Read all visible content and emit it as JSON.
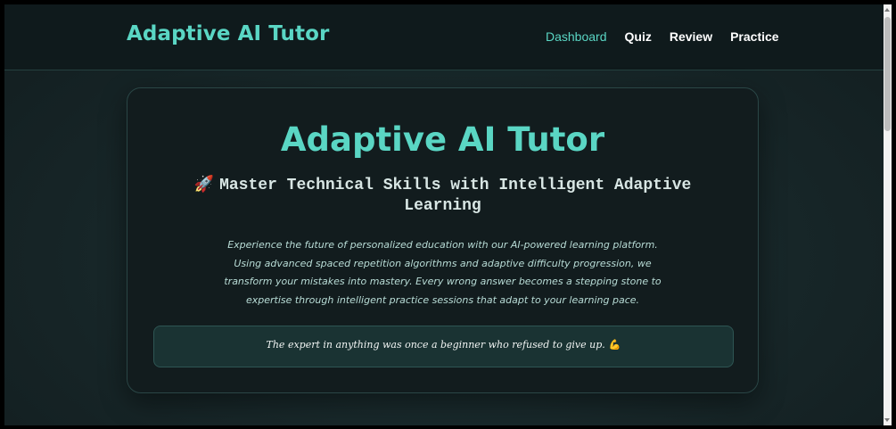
{
  "navbar": {
    "brand": "Adaptive AI Tutor",
    "links": [
      {
        "label": "Dashboard",
        "active": true
      },
      {
        "label": "Quiz",
        "active": false
      },
      {
        "label": "Review",
        "active": false
      },
      {
        "label": "Practice",
        "active": false
      }
    ]
  },
  "hero": {
    "title": "Adaptive AI Tutor",
    "subtitle_icon": "🚀",
    "subtitle": "Master Technical Skills with Intelligent Adaptive Learning",
    "description": "Experience the future of personalized education with our AI-powered learning platform. Using advanced spaced repetition algorithms and adaptive difficulty progression, we transform your mistakes into mastery. Every wrong answer becomes a stepping stone to expertise through intelligent practice sessions that adapt to your learning pace.",
    "quote": "The expert in anything was once a beginner who refused to give up.",
    "quote_icon": "💪"
  },
  "colors": {
    "accent": "#5ad6c4",
    "background": "#172628",
    "card": "#121c1e"
  },
  "icons": {
    "rocket": "rocket-icon",
    "muscle": "flexed-biceps-icon"
  }
}
